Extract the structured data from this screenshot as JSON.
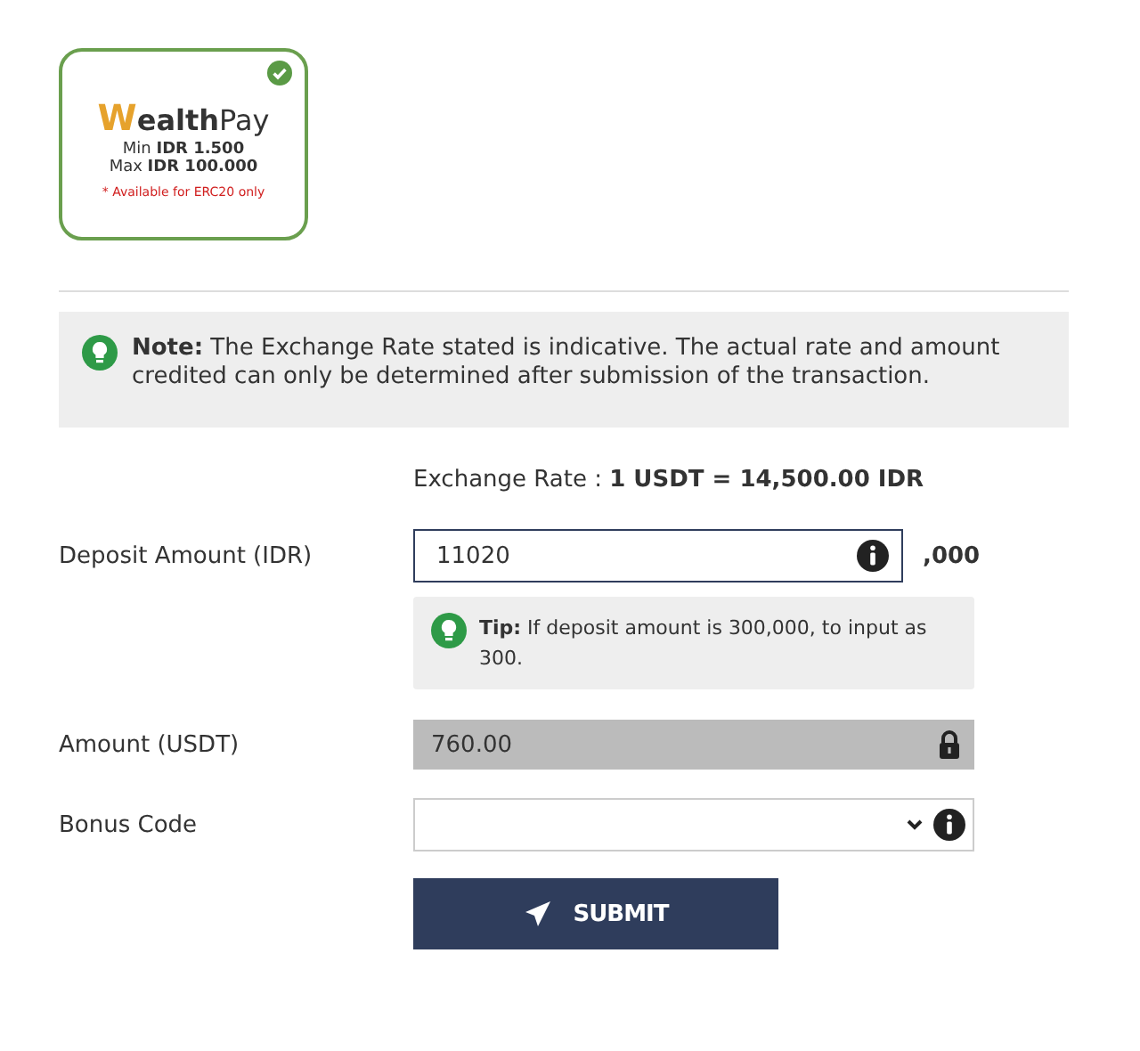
{
  "payment_method": {
    "logo": {
      "mark": "W",
      "bold": "ealth",
      "light": "Pay"
    },
    "selected": true,
    "min": "Min **IDR 1.500**",
    "max": "Max **IDR 100.000**",
    "availability": "* Available for ERC20 only"
  },
  "note": "**Note:** The Exchange Rate stated is indicative. The actual rate and amount credited can only be determined after submission of the transaction.",
  "exchange_rate": "Exchange Rate : **1 USDT = 14,500.00 IDR**",
  "deposit": {
    "label": "Deposit Amount (IDR)",
    "value": "11020",
    "suffix": ",000",
    "tip": "**Tip:** If deposit amount is 300,000, to input as 300."
  },
  "amount": {
    "label": "Amount (USDT)",
    "value": "760.00",
    "disabled": true
  },
  "bonus": {
    "label": "Bonus Code"
  },
  "submit": {
    "label": "SUBMIT"
  }
}
